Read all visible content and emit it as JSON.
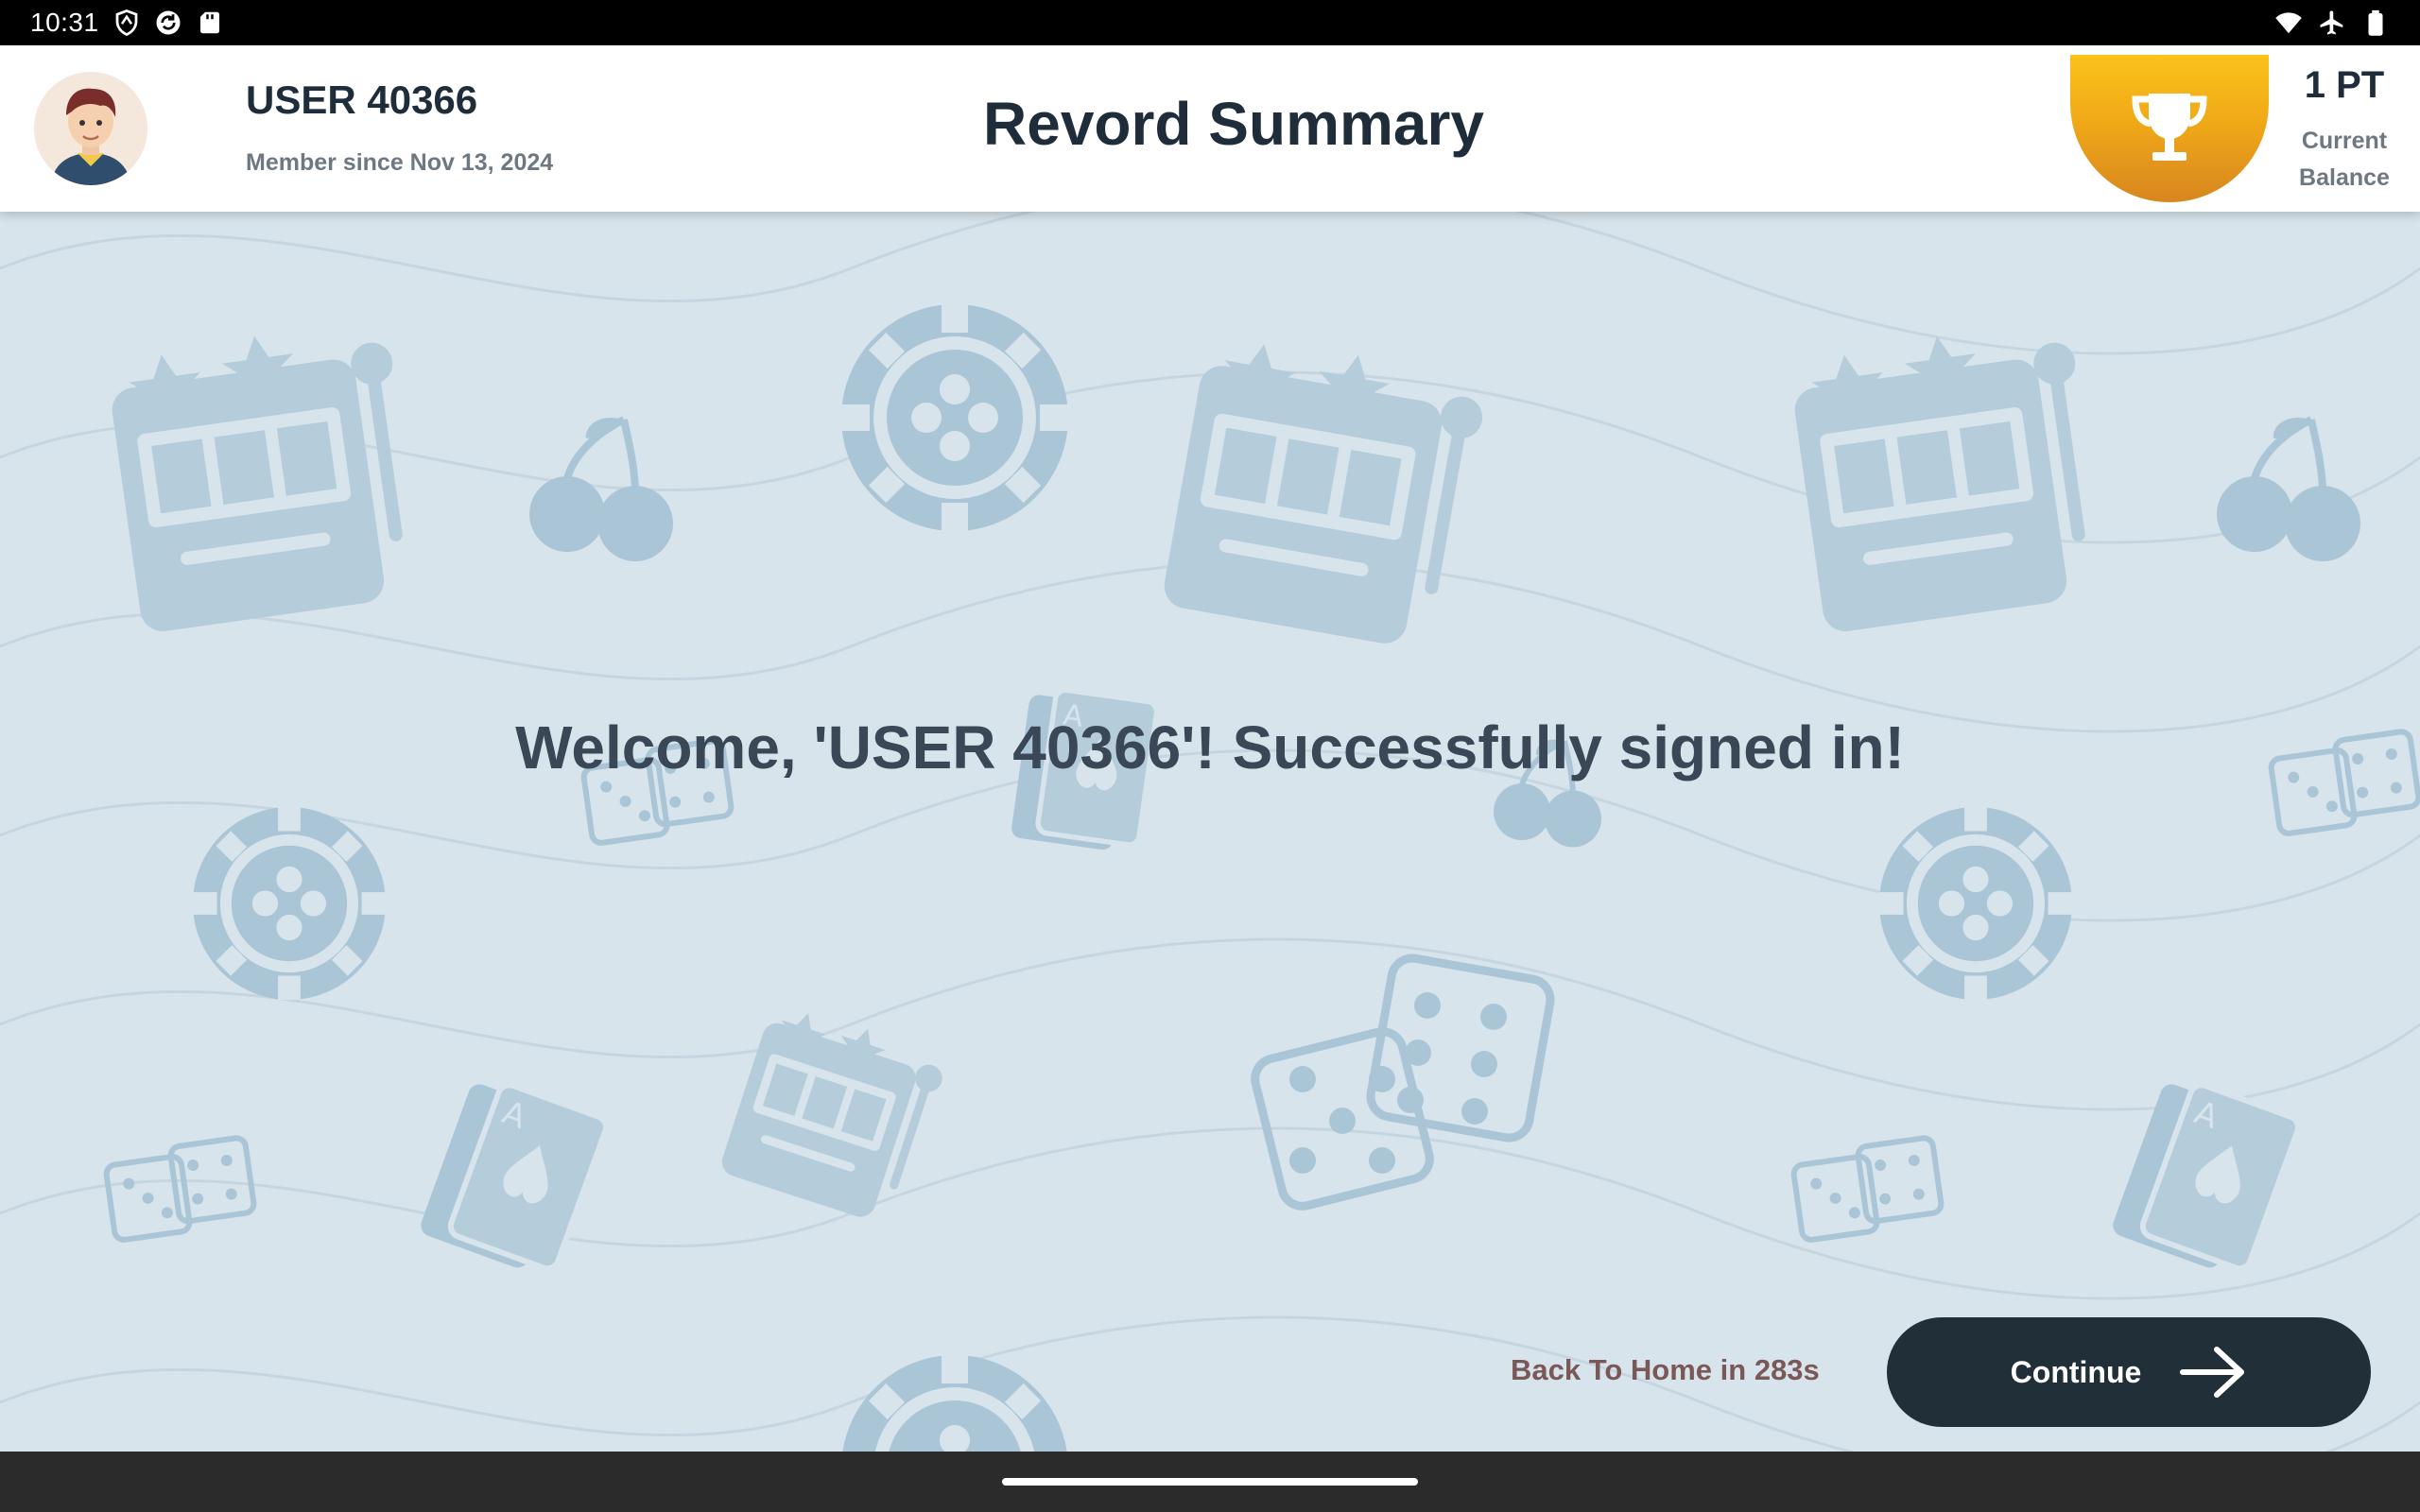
{
  "status_bar": {
    "time": "10:31",
    "icons_left": [
      "shield-icon",
      "sync-icon",
      "sd-card-icon"
    ],
    "icons_right": [
      "wifi-icon",
      "airplane-icon",
      "battery-icon"
    ]
  },
  "header": {
    "user_name": "USER 40366",
    "member_since": "Member since Nov 13, 2024",
    "title": "Revord Summary",
    "balance_value": "1 PT",
    "balance_label_line1": "Current",
    "balance_label_line2": "Balance"
  },
  "main": {
    "welcome_message": "Welcome, 'USER 40366'! Successfully signed in!",
    "back_home_prefix": "Back To Home in",
    "countdown": "283s",
    "continue_label": "Continue"
  },
  "colors": {
    "background": "#d8e4ec",
    "pattern": "#aac6d6",
    "button": "#212f38",
    "trophy_gold": "#f0a918",
    "title_text": "#1f2d3a"
  }
}
